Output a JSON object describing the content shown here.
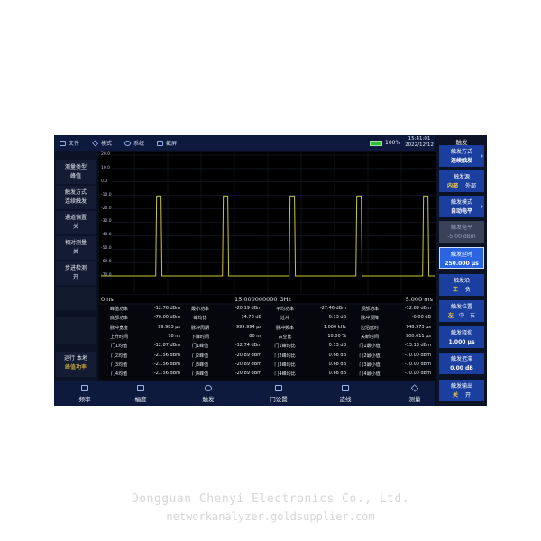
{
  "topbar": {
    "menu": [
      {
        "label": "文件",
        "icon": "folder-icon"
      },
      {
        "label": "模式",
        "icon": "cube-icon"
      },
      {
        "label": "系统",
        "icon": "gear-icon"
      },
      {
        "label": "截屏",
        "icon": "camera-icon"
      }
    ],
    "battery": "100%",
    "time": "15:41:01",
    "date": "2022/12/12"
  },
  "left_panel": {
    "items": [
      {
        "title": "测量类型",
        "value": "峰值"
      },
      {
        "title": "触发方式",
        "value": "连续触发"
      },
      {
        "title": "通道偏置",
        "value": "关"
      },
      {
        "title": "相对测量",
        "value": "关"
      },
      {
        "title": "步进检测",
        "value": "开"
      }
    ],
    "run_status": "运行 本地",
    "run_mode": "峰值功率"
  },
  "plot": {
    "y_labels": [
      "20.0",
      "10.0",
      "0.0",
      "-10.0",
      "-20.0",
      "-30.0",
      "-40.0",
      "-50.0",
      "-60.0",
      "-70.0"
    ],
    "trace_color": "#c9c53a",
    "x_start": "0 ns",
    "x_center": "15.000000000 GHz",
    "x_end": "5.000 ms"
  },
  "chart_data": {
    "type": "line",
    "y_ticks": [
      20,
      10,
      0,
      -10,
      -20,
      -30,
      -40,
      -50,
      -60,
      -70
    ],
    "ylim": [
      -75,
      22
    ],
    "x_start": "0 ns",
    "x_end": "5.000 ms",
    "series": [
      {
        "pulses": [
          [
            0.82,
            0.9
          ],
          [
            1.82,
            1.9
          ],
          [
            2.82,
            2.9
          ],
          [
            3.82,
            3.9
          ],
          [
            4.82,
            4.9
          ]
        ],
        "high_dBm": -10.5,
        "low_dBm": -70,
        "x_unit": "ms"
      }
    ]
  },
  "table": {
    "rows": [
      [
        "峰值功率",
        "-12.76 dBm",
        "最小功率",
        "-20.19 dBm",
        "平均功率",
        "-27.46 dBm",
        "顶部功率",
        "-12.89 dBm"
      ],
      [
        "底部功率",
        "-70.00 dBm",
        "峰均比",
        "14.70 dB",
        "过冲",
        "0.13 dB",
        "脉冲顶降",
        "-0.00 dB"
      ],
      [
        "脉冲宽度",
        "99.983 μs",
        "脉冲周期",
        "999.994 μs",
        "脉冲频率",
        "1.000 kHz",
        "边沿延时",
        "748.973 μs"
      ],
      [
        "上升时间",
        "78 ns",
        "下降时间",
        "80 ns",
        "占空比",
        "10.00 %",
        "关断时间",
        "900.011 μs"
      ],
      [
        "门1均值",
        "-12.87 dBm",
        "门1峰值",
        "-12.74 dBm",
        "门1峰均比",
        "0.13 dB",
        "门1最小值",
        "-13.13 dBm"
      ],
      [
        "门2均值",
        "-21.56 dBm",
        "门2峰值",
        "-20.89 dBm",
        "门2峰均比",
        "0.68 dB",
        "门2最小值",
        "-70.00 dBm"
      ],
      [
        "门3均值",
        "-21.56 dBm",
        "门3峰值",
        "-20.89 dBm",
        "门3峰均比",
        "0.68 dB",
        "门3最小值",
        "-70.00 dBm"
      ],
      [
        "门4均值",
        "-21.56 dBm",
        "门4峰值",
        "-20.89 dBm",
        "门4峰均比",
        "0.68 dB",
        "门4最小值",
        "-70.00 dBm"
      ]
    ]
  },
  "bottom_bar": {
    "items": [
      {
        "label": "频率",
        "icon": "frequency-icon"
      },
      {
        "label": "幅度",
        "icon": "amplitude-icon"
      },
      {
        "label": "触发",
        "icon": "trigger-icon"
      },
      {
        "label": "门设置",
        "icon": "gate-icon"
      },
      {
        "label": "迹线",
        "icon": "trace-icon"
      },
      {
        "label": "测量",
        "icon": "measure-icon"
      }
    ]
  },
  "right_panel": {
    "title": "触发",
    "mode_label": "触发方式",
    "mode_value": "连续触发",
    "source_label": "触发源",
    "source_opt1": "内部",
    "source_opt2": "外部",
    "tmode_label": "触发模式",
    "tmode_value": "自动电平",
    "level_label": "触发电平",
    "level_value": "-5.00 dBm",
    "delay_label": "触发延时",
    "delay_value": "250.000 μs",
    "edge_label": "触发沿",
    "edge_opt1": "正",
    "edge_opt2": "负",
    "pos_label": "触发位置",
    "pos_opt1": "左",
    "pos_opt2": "中",
    "pos_opt3": "右",
    "hold_label": "触发释抑",
    "hold_value": "1.000 μs",
    "hyst_label": "触发迟滞",
    "hyst_value": "0.00 dB",
    "out_label": "触发输出",
    "out_opt1": "关",
    "out_opt2": "开"
  },
  "watermark": {
    "line1": "Dongguan Chenyi Electronics Co., Ltd.",
    "line2": "networkanalyzer.goldsupplier.com"
  }
}
